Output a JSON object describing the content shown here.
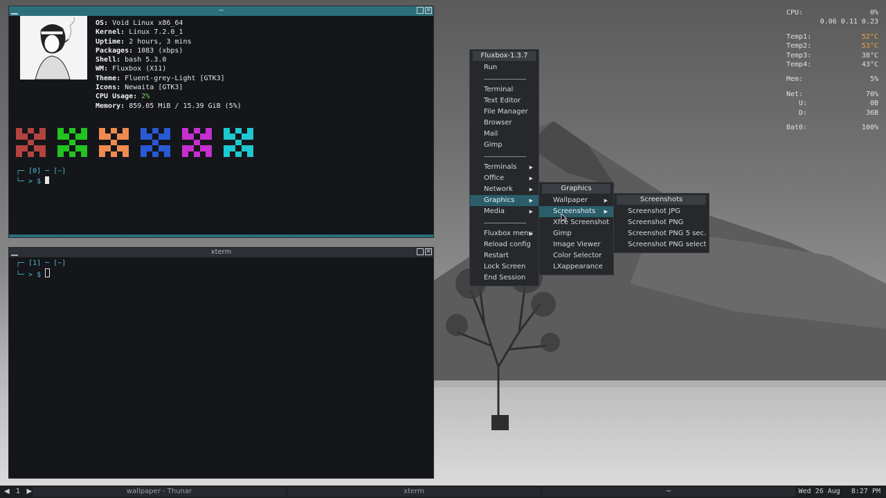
{
  "terminal1": {
    "title": "~",
    "fetch": [
      {
        "key": "OS:",
        "value": "Void Linux x86_64"
      },
      {
        "key": "Kernel:",
        "value": "Linux 7.2.0_1"
      },
      {
        "key": "Uptime:",
        "value": "2 hours, 3 mins"
      },
      {
        "key": "Packages:",
        "value": "1083 (xbps)"
      },
      {
        "key": "Shell:",
        "value": "bash 5.3.0"
      },
      {
        "key": "WM:",
        "value": "Fluxbox (X11)"
      },
      {
        "key": "Theme:",
        "value": "Fluent-grey-Light [GTK3]"
      },
      {
        "key": "Icons:",
        "value": "Newaita [GTK3]"
      },
      {
        "key": "CPU Usage:",
        "value": "2%"
      },
      {
        "key": "Memory:",
        "value": "859.05 MiB / 15.39 GiB (5%)"
      }
    ],
    "prompt_line1": "┌─ [0] ─ [~]",
    "prompt_line2": "└─ > $",
    "block_colors": [
      "#b5433f",
      "#22c41f",
      "#ef8a50",
      "#2a59d4",
      "#c52fcf",
      "#1ec8d1"
    ]
  },
  "terminal2": {
    "title": "xterm",
    "prompt_line1": "┌─ [1] ─ [~]",
    "prompt_line2": "└─ > $"
  },
  "conky": {
    "cpu_label": "CPU:",
    "cpu_value": "0%",
    "load": "0.06 0.11 0.23",
    "temps": [
      {
        "label": "Temp1:",
        "value": "52°C",
        "warm": true
      },
      {
        "label": "Temp2:",
        "value": "53°C",
        "warm": true
      },
      {
        "label": "Temp3:",
        "value": "38°C",
        "warm": false
      },
      {
        "label": "Temp4:",
        "value": "43°C",
        "warm": false
      }
    ],
    "mem_label": "Mem:",
    "mem_value": "5%",
    "net_label": "Net:",
    "net_value": "70%",
    "up_label": "U:",
    "up_value": "0B",
    "down_label": "D:",
    "down_value": "36B",
    "bat_label": "Bat0:",
    "bat_value": "100%"
  },
  "root_menu": {
    "title": "Fluxbox-1.3.7",
    "items": [
      {
        "label": "Run"
      },
      {
        "sep": true
      },
      {
        "label": "Terminal"
      },
      {
        "label": "Text Editor"
      },
      {
        "label": "File Manager"
      },
      {
        "label": "Browser"
      },
      {
        "label": "Mail"
      },
      {
        "label": "Gimp"
      },
      {
        "sep": true
      },
      {
        "label": "Terminals",
        "sub": true
      },
      {
        "label": "Office",
        "sub": true
      },
      {
        "label": "Network",
        "sub": true
      },
      {
        "label": "Graphics",
        "sub": true,
        "selected": true
      },
      {
        "label": "Media",
        "sub": true
      },
      {
        "sep": true
      },
      {
        "label": "Fluxbox menu",
        "sub": true
      },
      {
        "label": "Reload config"
      },
      {
        "label": "Restart"
      },
      {
        "label": "Lock Screen"
      },
      {
        "label": "End Session"
      }
    ]
  },
  "graphics_menu": {
    "title": "Graphics",
    "items": [
      {
        "label": "Wallpaper",
        "sub": true
      },
      {
        "label": "Screenshots",
        "sub": true,
        "selected": true
      },
      {
        "label": "Xfce Screenshot"
      },
      {
        "label": "Gimp"
      },
      {
        "label": "Image Viewer"
      },
      {
        "label": "Color Selector"
      },
      {
        "label": "LXappearance"
      }
    ]
  },
  "screenshots_menu": {
    "title": "Screenshots",
    "items": [
      {
        "label": "Screenshot JPG"
      },
      {
        "label": "Screenshot PNG"
      },
      {
        "label": "Screenshot PNG 5 sec."
      },
      {
        "label": "Screenshot PNG select"
      }
    ]
  },
  "taskbar": {
    "workspace": "1",
    "tasks": [
      "wallpaper - Thunar",
      "xterm",
      "~"
    ],
    "date": "Wed 26 Aug",
    "time": "8:27 PM"
  }
}
